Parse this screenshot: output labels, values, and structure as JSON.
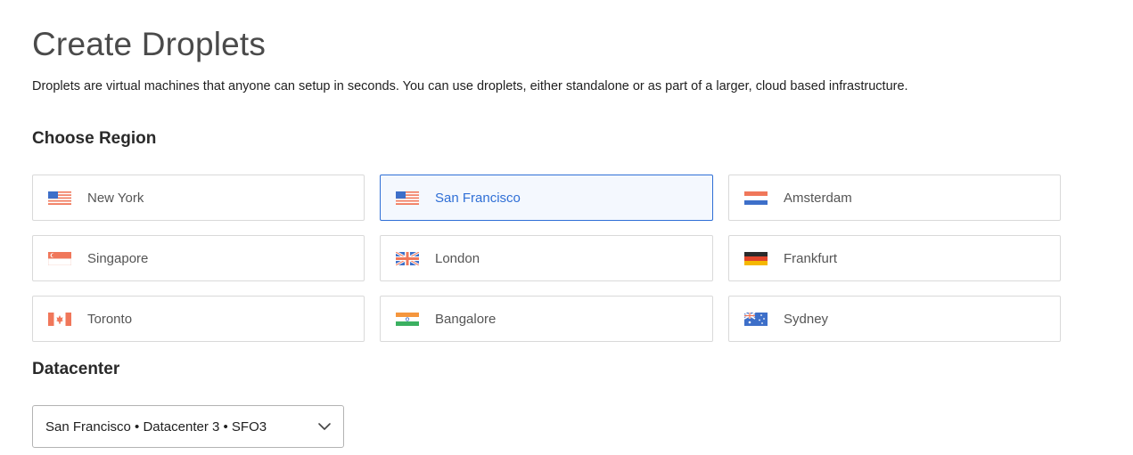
{
  "header": {
    "title": "Create Droplets",
    "description": "Droplets are virtual machines that anyone can setup in seconds. You can use droplets, either standalone or as part of a larger, cloud based infrastructure."
  },
  "region": {
    "heading": "Choose Region",
    "selected": "San Francisco",
    "items": [
      {
        "label": "New York",
        "flag": "us-flag-icon"
      },
      {
        "label": "San Francisco",
        "flag": "us-flag-icon"
      },
      {
        "label": "Amsterdam",
        "flag": "netherlands-flag-icon"
      },
      {
        "label": "Singapore",
        "flag": "singapore-flag-icon"
      },
      {
        "label": "London",
        "flag": "uk-flag-icon"
      },
      {
        "label": "Frankfurt",
        "flag": "germany-flag-icon"
      },
      {
        "label": "Toronto",
        "flag": "canada-flag-icon"
      },
      {
        "label": "Bangalore",
        "flag": "india-flag-icon"
      },
      {
        "label": "Sydney",
        "flag": "australia-flag-icon"
      }
    ]
  },
  "datacenter": {
    "heading": "Datacenter",
    "selected_value": "San Francisco • Datacenter 3 • SFO3"
  },
  "colors": {
    "accent": "#2f6fd6",
    "selected_bg": "#f4f8fe",
    "card_border": "#d9d9d9",
    "flag_red": "#f0775a",
    "flag_blue": "#3d6fc9",
    "flag_black": "#2b2b2b",
    "flag_gold": "#f5b800",
    "flag_green": "#3bb061"
  }
}
